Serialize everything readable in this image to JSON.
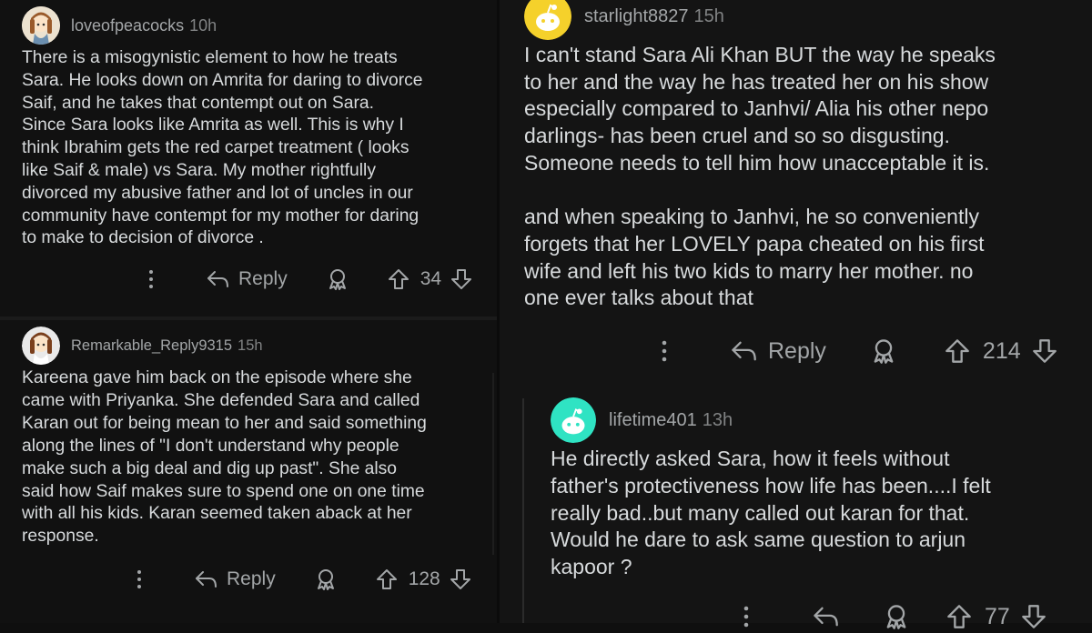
{
  "comments": [
    {
      "username": "loveofpeacocks",
      "time": "10h",
      "body": "There is a misogynistic element to how he treats\nSara. He looks down on Amrita for daring to divorce\nSaif, and he takes that contempt out on Sara.\nSince Sara looks like Amrita as well. This is why I\nthink Ibrahim gets the red carpet treatment ( looks\nlike Saif & male) vs Sara. My mother rightfully\ndivorced my abusive father and lot of uncles in our\ncommunity have contempt for my mother for daring\nto make to decision of divorce .",
      "reply_label": "Reply",
      "votes": "34"
    },
    {
      "username": "Remarkable_Reply9315",
      "time": "15h",
      "body": "Kareena gave him back on the episode where she\ncame with Priyanka. She defended Sara and called\nKaran out for being mean to her and said something\nalong the lines of \"I don't understand why people\nmake such a big deal and dig up past\". She also\nsaid how Saif makes sure to spend one on one time\nwith all his kids. Karan seemed taken aback at her\nresponse.",
      "reply_label": "Reply",
      "votes": "128"
    },
    {
      "username": "starlight8827",
      "time": "15h",
      "body": "I can't stand Sara Ali Khan BUT the way he speaks\nto her and the way he has treated her on his show\nespecially compared to Janhvi/ Alia his other nepo\ndarlings- has been cruel and so so disgusting.\nSomeone needs to tell him how unacceptable it is.\n\nand when speaking to Janhvi, he so conveniently\nforgets that her LOVELY papa cheated on his first\nwife and left his two kids to marry her mother. no\none ever talks about that",
      "reply_label": "Reply",
      "votes": "214"
    },
    {
      "username": "lifetime401",
      "time": "13h",
      "body": "He directly asked Sara, how it feels without\nfather's protectiveness how life has been....I felt\nreally bad..but many called out karan for that.\nWould he dare to ask same question  to arjun\nkapoor ?",
      "votes": "77"
    }
  ],
  "icons": {
    "more": "more-options-icon",
    "reply": "reply-arrow-icon",
    "award": "award-icon",
    "upvote": "upvote-arrow-icon",
    "downvote": "downvote-arrow-icon"
  },
  "colors": {
    "background": "#111111",
    "text": "#d7dadc",
    "muted": "#a3a6a8",
    "avatar_yellow": "#f5d12b",
    "avatar_teal": "#2fe3c3"
  }
}
